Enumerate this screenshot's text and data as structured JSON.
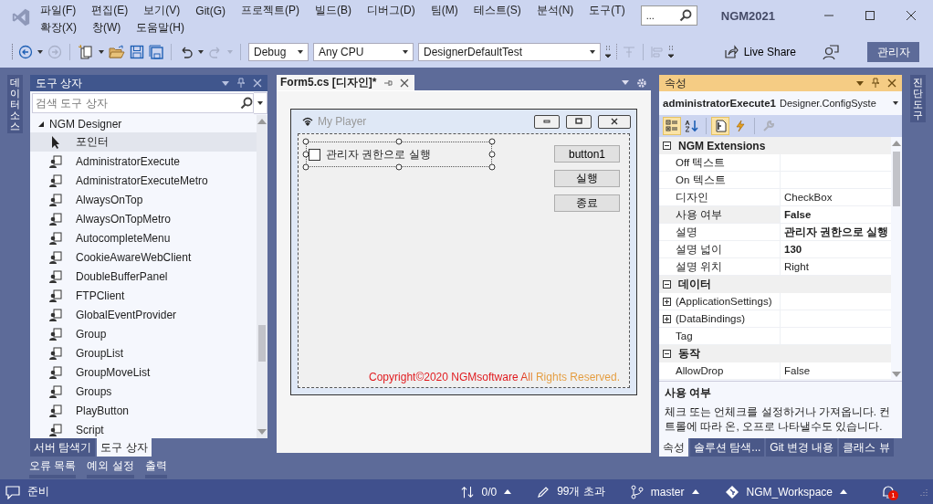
{
  "window": {
    "title": "NGM2021",
    "search": "..."
  },
  "menu_rows": [
    [
      "파일(F)",
      "편집(E)",
      "보기(V)",
      "Git(G)",
      "프로젝트(P)",
      "빌드(B)",
      "디버그(D)",
      "팀(M)",
      "테스트(S)",
      "분석(N)",
      "도구(T)"
    ],
    [
      "확장(X)",
      "창(W)",
      "도움말(H)"
    ]
  ],
  "toolbar": {
    "configuration": "Debug",
    "platform": "Any CPU",
    "startup": "DesignerDefaultTest",
    "live_share": "Live Share",
    "admin": "관리자"
  },
  "left_side_tab": "데이터 소스",
  "right_side_tab": "진단 도구",
  "toolbox": {
    "title": "도구 상자",
    "search_placeholder": "검색 도구 상자",
    "group": {
      "label": "NGM Designer",
      "expanded": true
    },
    "items": [
      {
        "label": "포인터",
        "kind": "pointer",
        "selected": true
      },
      {
        "label": "AdministratorExecute",
        "kind": "component",
        "selected": false
      },
      {
        "label": "AdministratorExecuteMetro",
        "kind": "component",
        "selected": false
      },
      {
        "label": "AlwaysOnTop",
        "kind": "component",
        "selected": false
      },
      {
        "label": "AlwaysOnTopMetro",
        "kind": "component",
        "selected": false
      },
      {
        "label": "AutocompleteMenu",
        "kind": "component",
        "selected": false
      },
      {
        "label": "CookieAwareWebClient",
        "kind": "component",
        "selected": false
      },
      {
        "label": "DoubleBufferPanel",
        "kind": "component",
        "selected": false
      },
      {
        "label": "FTPClient",
        "kind": "component",
        "selected": false
      },
      {
        "label": "GlobalEventProvider",
        "kind": "component",
        "selected": false
      },
      {
        "label": "Group",
        "kind": "component",
        "selected": false
      },
      {
        "label": "GroupList",
        "kind": "component",
        "selected": false
      },
      {
        "label": "GroupMoveList",
        "kind": "component",
        "selected": false
      },
      {
        "label": "Groups",
        "kind": "component",
        "selected": false
      },
      {
        "label": "PlayButton",
        "kind": "component",
        "selected": false
      },
      {
        "label": "Script",
        "kind": "component",
        "selected": false
      }
    ],
    "tabs": [
      {
        "label": "서버 탐색기",
        "selected": false
      },
      {
        "label": "도구 상자",
        "selected": true
      }
    ]
  },
  "document": {
    "tab": {
      "label": "Form5.cs [디자인]*",
      "selected": true
    },
    "form": {
      "title": "My Player",
      "checkbox": {
        "label": "관리자 권한으로 실행",
        "checked": false
      },
      "buttons": [
        "button1",
        "실행",
        "종료"
      ],
      "copyright": "Copyright©2020 NGMsoftware All Rights Reserved."
    }
  },
  "properties": {
    "title": "속성",
    "object_name": "administratorExecute1",
    "object_type": "Designer.ConfigSyste",
    "toolbar": [
      {
        "kind": "categorized",
        "selected": true,
        "disabled": false
      },
      {
        "kind": "alphabetical",
        "selected": false,
        "disabled": false
      },
      {
        "kind": "properties",
        "selected": true,
        "disabled": false
      },
      {
        "kind": "events",
        "selected": false,
        "disabled": false
      },
      {
        "kind": "pages",
        "selected": false,
        "disabled": true
      }
    ],
    "categories": [
      {
        "name": "NGM Extensions",
        "expanded": true,
        "rows": [
          {
            "name": "Off 텍스트",
            "selected": false
          },
          {
            "name": "On 텍스트",
            "selected": false
          },
          {
            "name": "디자인",
            "value": "CheckBox",
            "modified": false,
            "selected": false
          },
          {
            "name": "사용 여부",
            "value": "False",
            "modified": true,
            "selected": true
          },
          {
            "name": "설명",
            "value": "관리자 권한으로 실행",
            "modified": true,
            "selected": false
          },
          {
            "name": "설명 넓이",
            "value": "130",
            "modified": true,
            "selected": false
          },
          {
            "name": "설명 위치",
            "value": "Right",
            "modified": false,
            "selected": false
          }
        ]
      },
      {
        "name": "데이터",
        "expanded": true,
        "rows": [
          {
            "name": "(ApplicationSettings)",
            "expanded": false,
            "selected": false
          },
          {
            "name": "(DataBindings)",
            "expanded": false,
            "selected": false
          },
          {
            "name": "Tag",
            "selected": false
          }
        ]
      },
      {
        "name": "동작",
        "expanded": true,
        "rows": [
          {
            "name": "AllowDrop",
            "value": "False",
            "modified": false,
            "selected": false
          }
        ]
      }
    ],
    "description": {
      "title": "사용 여부",
      "text": "체크 또는 언체크를 설정하거나 가져옵니다. 컨트롤에 따라 온, 오프로 나타낼수도 있습니다."
    },
    "tabs": [
      {
        "label": "속성",
        "selected": true
      },
      {
        "label": "솔루션 탐색...",
        "selected": false
      },
      {
        "label": "Git 변경 내용",
        "selected": false
      },
      {
        "label": "클래스 뷰",
        "selected": false
      }
    ]
  },
  "bottom_tabs": [
    "오류 목록",
    "예외 설정",
    "출력"
  ],
  "status_bar": {
    "ready": "준비",
    "sync": "0/0",
    "errors": "99개 초과",
    "branch": "master",
    "repository": "NGM_Workspace",
    "notifications": "1"
  }
}
